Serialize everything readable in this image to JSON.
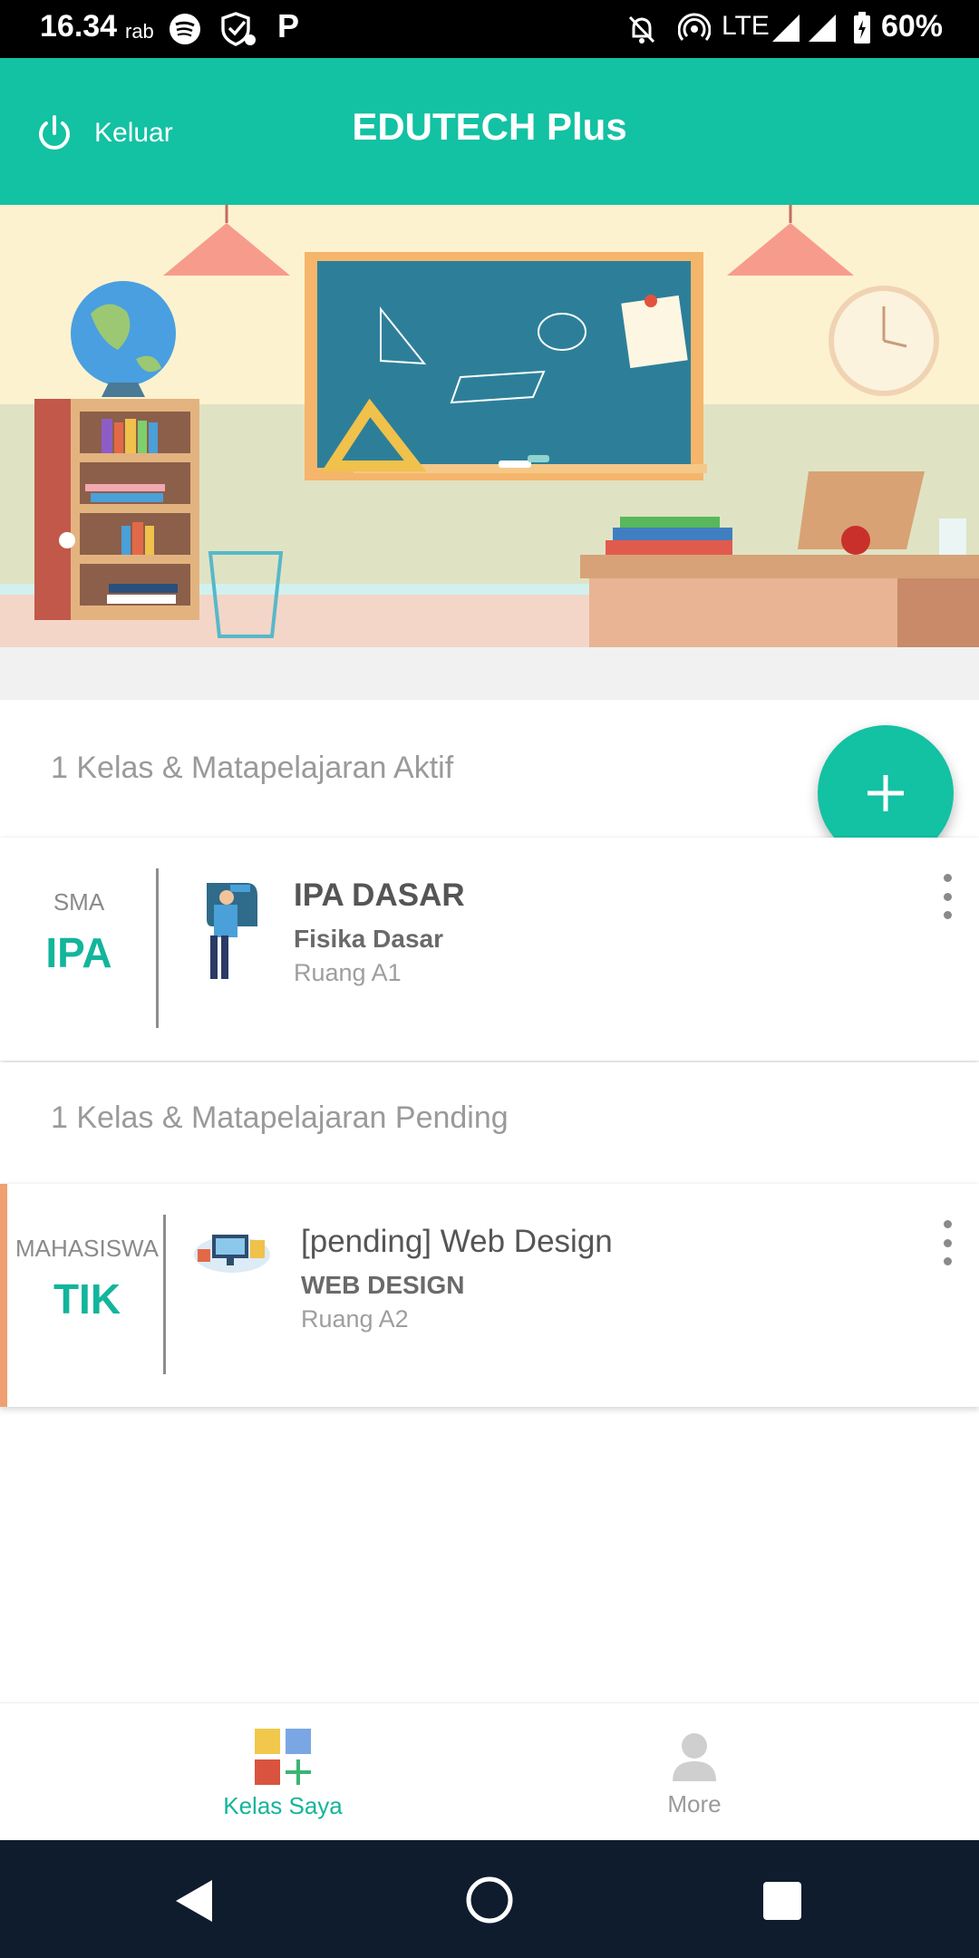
{
  "status_bar": {
    "time": "16.34",
    "day": "rab",
    "network": "LTE",
    "battery": "60%"
  },
  "app_bar": {
    "title": "EDUTECH Plus",
    "logout_label": "Keluar"
  },
  "active_section": {
    "label": "1 Kelas & Matapelajaran Aktif",
    "classes": [
      {
        "level": "SMA",
        "abbr": "IPA",
        "name": "IPA DASAR",
        "subject": "Fisika Dasar",
        "room": "Ruang A1"
      }
    ]
  },
  "pending_section": {
    "label": "1 Kelas & Matapelajaran Pending",
    "classes": [
      {
        "level": "MAHASISWA",
        "abbr": "TIK",
        "name": "[pending] Web Design",
        "subject": "WEB DESIGN",
        "room": "Ruang A2",
        "accent_color": "#f0a070"
      }
    ]
  },
  "bottom_nav": {
    "items": [
      {
        "label": "Kelas Saya",
        "active": true
      },
      {
        "label": "More",
        "active": false
      }
    ]
  },
  "colors": {
    "primary": "#13c1a3",
    "pending_accent": "#f0a070",
    "status_bar": "#000000",
    "system_nav": "#0f1c2d"
  }
}
